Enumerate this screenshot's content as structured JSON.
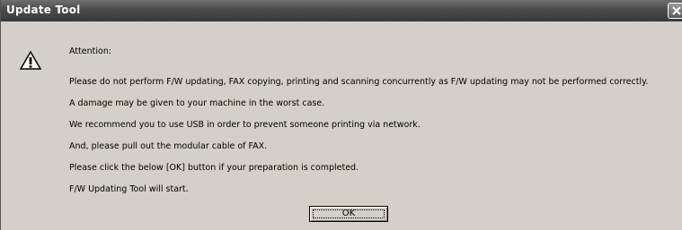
{
  "window": {
    "title": "Update Tool"
  },
  "dialog": {
    "icon": "warning-icon",
    "lines": [
      "Attention:",
      "Please do not perform F/W updating, FAX copying, printing and scanning concurrently as F/W updating may not be performed correctly.",
      "A damage may be given to your machine in the worst case.",
      "We recommend you to use USB in order to prevent someone printing via network.",
      "And, please pull out the modular cable of FAX.",
      "Please click the below [OK] button if your preparation is completed.",
      "F/W Updating Tool will start."
    ],
    "ok_label": "OK"
  },
  "colors": {
    "titlebar": "#4a4a4a",
    "dialog_bg": "#d4d0c8"
  }
}
